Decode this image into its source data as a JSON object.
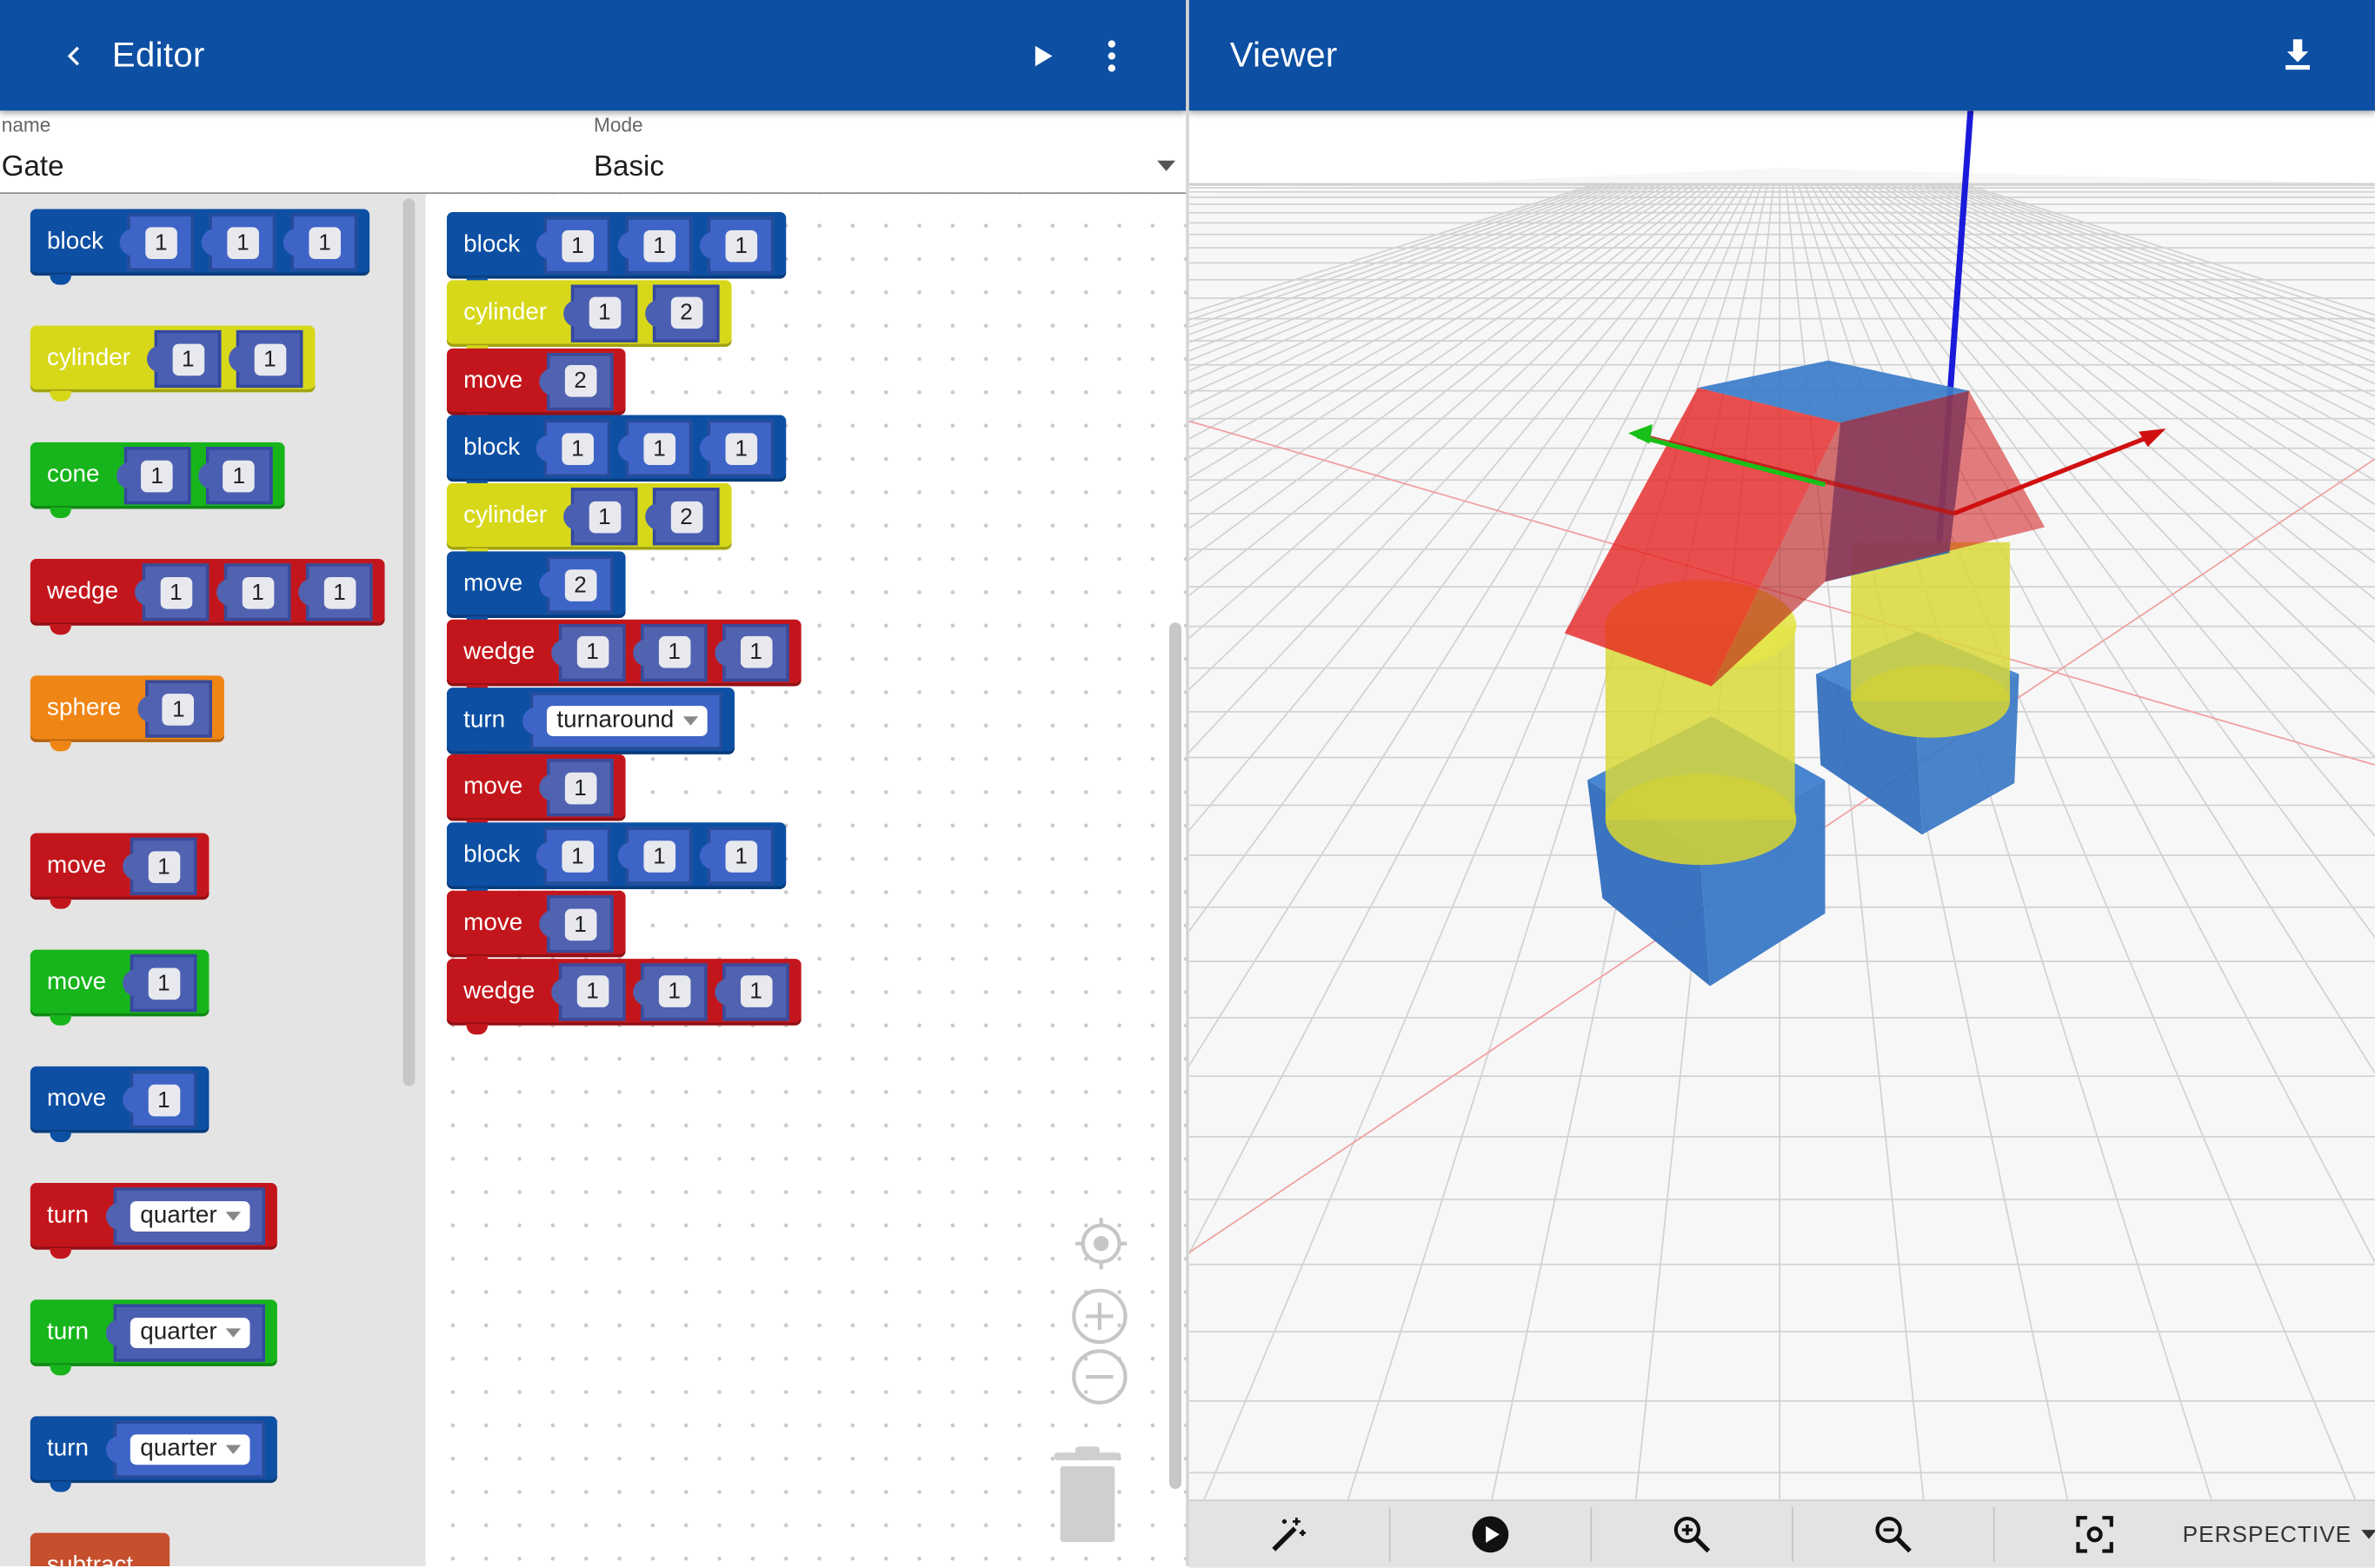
{
  "editor": {
    "title": "Editor",
    "back_icon": "chevron-left-icon",
    "run_icon": "play-icon",
    "menu_icon": "more-vert-icon",
    "name_label": "name",
    "name_value": "Gate",
    "mode_label": "Mode",
    "mode_value": "Basic"
  },
  "viewer": {
    "title": "Viewer",
    "download_icon": "download-icon",
    "toolbar": {
      "wand_icon": "magic-wand-icon",
      "play_icon": "play-circle-icon",
      "zoom_in_icon": "zoom-in-icon",
      "zoom_out_icon": "zoom-out-icon",
      "focus_icon": "center-focus-icon",
      "projection_value": "PERSPECTIVE"
    }
  },
  "toolbox": [
    {
      "label": "block",
      "color": "#0d4fa3",
      "inputs": [
        "1",
        "1",
        "1"
      ]
    },
    {
      "label": "cylinder",
      "color": "#d7d81a",
      "inputs": [
        "1",
        "1"
      ]
    },
    {
      "label": "cone",
      "color": "#17b51b",
      "inputs": [
        "1",
        "1"
      ]
    },
    {
      "label": "wedge",
      "color": "#c3161c",
      "inputs": [
        "1",
        "1",
        "1"
      ]
    },
    {
      "label": "sphere",
      "color": "#ef8515",
      "inputs": [
        "1"
      ]
    },
    {
      "label": "move",
      "color": "#c3161c",
      "inputs": [
        "1"
      ]
    },
    {
      "label": "move",
      "color": "#17b51b",
      "inputs": [
        "1"
      ]
    },
    {
      "label": "move",
      "color": "#0d4fa3",
      "inputs": [
        "1"
      ]
    },
    {
      "label": "turn",
      "color": "#c3161c",
      "dropdown": "quarter"
    },
    {
      "label": "turn",
      "color": "#17b51b",
      "dropdown": "quarter"
    },
    {
      "label": "turn",
      "color": "#0d4fa3",
      "dropdown": "quarter"
    },
    {
      "label": "subtract",
      "color": "#c64f2d"
    }
  ],
  "program": [
    {
      "label": "block",
      "color": "#0d4fa3",
      "inputs": [
        "1",
        "1",
        "1"
      ]
    },
    {
      "label": "cylinder",
      "color": "#d7d81a",
      "inputs": [
        "1",
        "2"
      ]
    },
    {
      "label": "move",
      "color": "#c3161c",
      "inputs": [
        "2"
      ]
    },
    {
      "label": "block",
      "color": "#0d4fa3",
      "inputs": [
        "1",
        "1",
        "1"
      ]
    },
    {
      "label": "cylinder",
      "color": "#d7d81a",
      "inputs": [
        "1",
        "2"
      ]
    },
    {
      "label": "move",
      "color": "#0d4fa3",
      "inputs": [
        "2"
      ]
    },
    {
      "label": "wedge",
      "color": "#c3161c",
      "inputs": [
        "1",
        "1",
        "1"
      ]
    },
    {
      "label": "turn",
      "color": "#0d4fa3",
      "dropdown": "turnaround"
    },
    {
      "label": "move",
      "color": "#c3161c",
      "inputs": [
        "1"
      ]
    },
    {
      "label": "block",
      "color": "#0d4fa3",
      "inputs": [
        "1",
        "1",
        "1"
      ]
    },
    {
      "label": "move",
      "color": "#c3161c",
      "inputs": [
        "1"
      ]
    },
    {
      "label": "wedge",
      "color": "#c3161c",
      "inputs": [
        "1",
        "1",
        "1"
      ]
    }
  ],
  "workspace_controls": {
    "recenter_icon": "target-icon",
    "zoom_in_icon": "zoom-plus-icon",
    "zoom_out_icon": "zoom-minus-icon",
    "trash_icon": "trash-can-icon"
  }
}
